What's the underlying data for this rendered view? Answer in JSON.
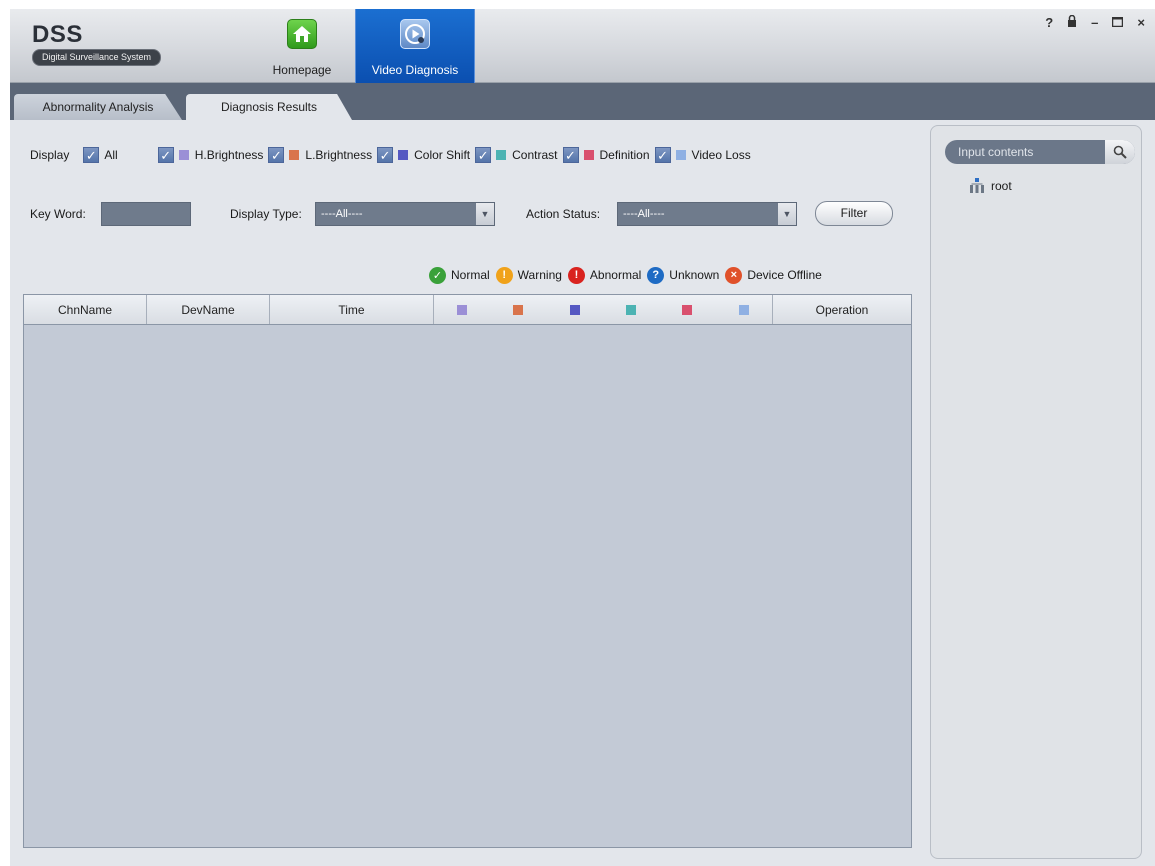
{
  "app": {
    "logo_title": "DSS",
    "logo_subtitle": "Digital Surveillance System"
  },
  "nav": {
    "homepage_label": "Homepage",
    "video_diagnosis_label": "Video Diagnosis"
  },
  "window_controls": {
    "help": "?",
    "lock": "🔒",
    "minimize": "–",
    "maximize": "▭",
    "close": "×"
  },
  "tabs": [
    {
      "label": "Abnormality Analysis",
      "active": false
    },
    {
      "label": "Diagnosis Results",
      "active": true
    }
  ],
  "display_filter": {
    "label": "Display",
    "all_label": "All",
    "items": [
      {
        "label": "H.Brightness",
        "color": "#9b8fd6",
        "checked": true
      },
      {
        "label": "L.Brightness",
        "color": "#d9744c",
        "checked": true
      },
      {
        "label": "Color Shift",
        "color": "#5558c2",
        "checked": true
      },
      {
        "label": "Contrast",
        "color": "#4cb3b3",
        "checked": true
      },
      {
        "label": "Definition",
        "color": "#d9506e",
        "checked": true
      },
      {
        "label": "Video Loss",
        "color": "#8fb0e3",
        "checked": true
      }
    ]
  },
  "search_row": {
    "keyword_label": "Key Word:",
    "keyword_value": "",
    "display_type_label": "Display Type:",
    "display_type_value": "----All----",
    "action_status_label": "Action Status:",
    "action_status_value": "----All----",
    "filter_button": "Filter"
  },
  "legend": [
    {
      "label": "Normal",
      "icon": "check-icon",
      "color": "#3aa13a",
      "glyph": "✓"
    },
    {
      "label": "Warning",
      "icon": "warning-icon",
      "color": "#f0a21a",
      "glyph": "!"
    },
    {
      "label": "Abnormal",
      "icon": "abnormal-icon",
      "color": "#d9231f",
      "glyph": "!"
    },
    {
      "label": "Unknown",
      "icon": "unknown-icon",
      "color": "#1e6bc4",
      "glyph": "?"
    },
    {
      "label": "Device Offline",
      "icon": "offline-icon",
      "color": "#e0512a",
      "glyph": "×"
    }
  ],
  "table": {
    "columns": [
      "ChnName",
      "DevName",
      "Time",
      "Operation"
    ],
    "rows": []
  },
  "right_panel": {
    "search_placeholder": "Input contents",
    "tree_root": "root"
  }
}
